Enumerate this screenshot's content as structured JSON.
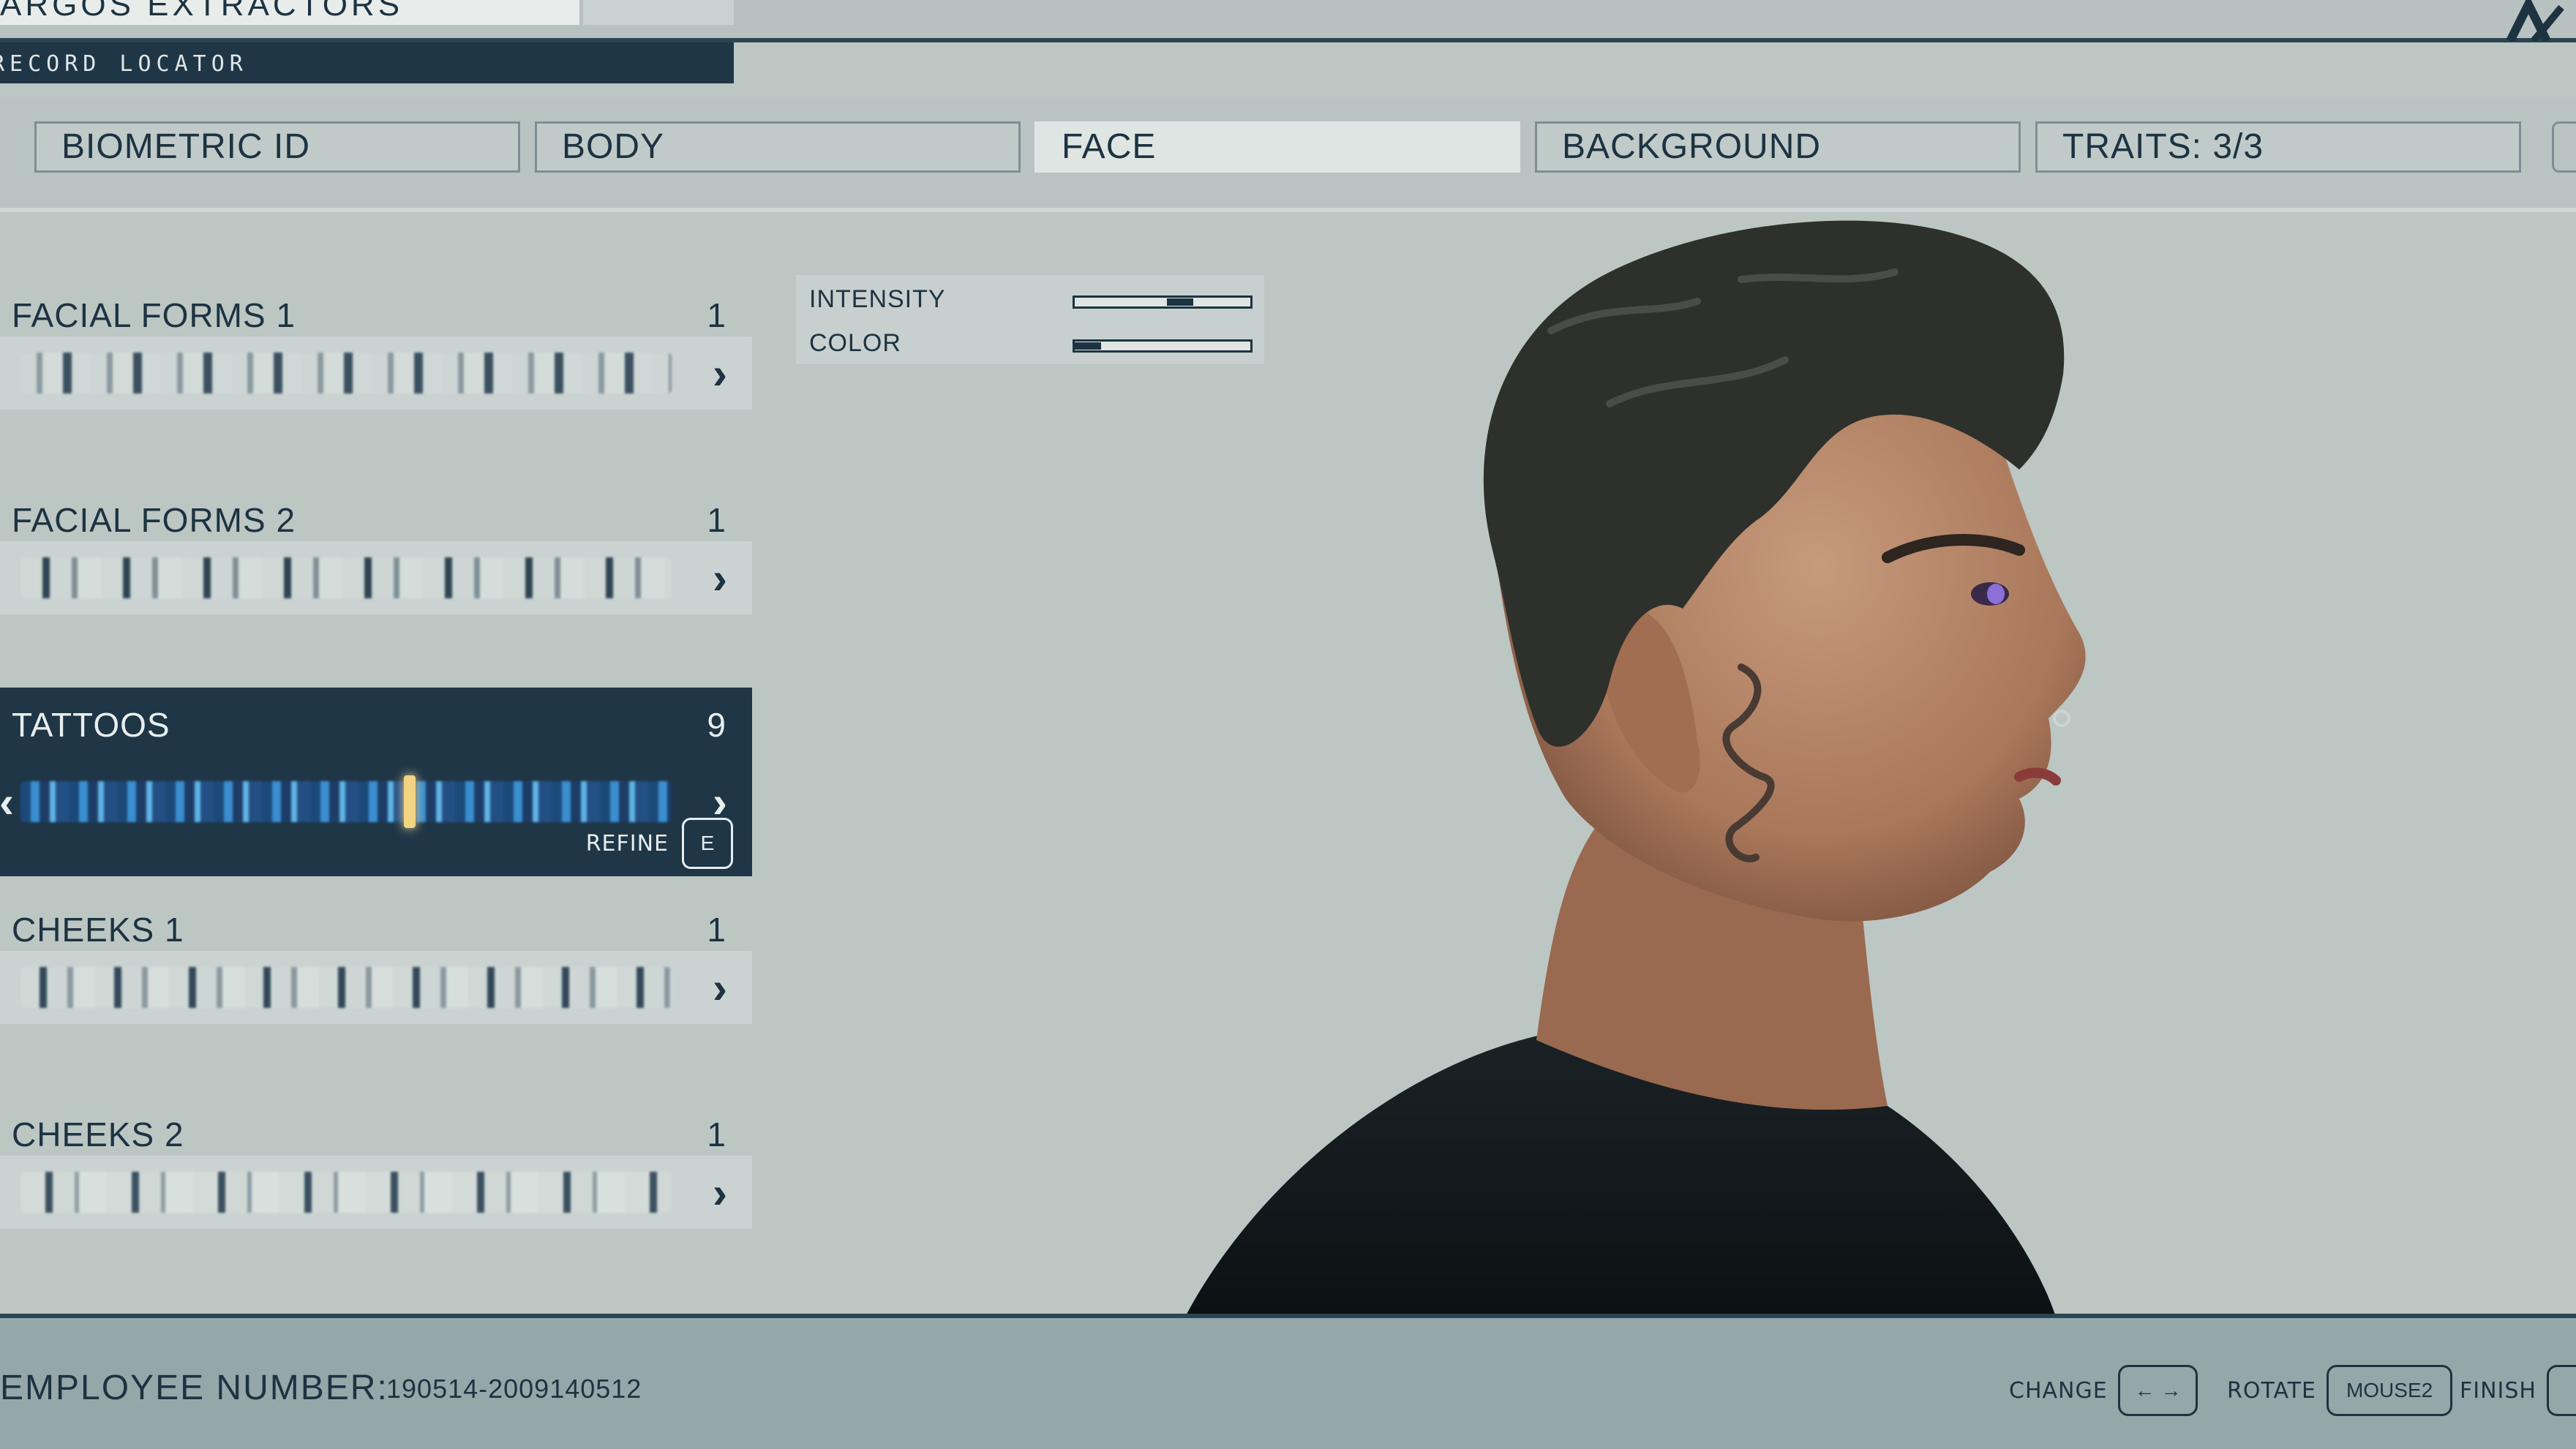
{
  "header": {
    "company": "ARGOS EXTRACTORS",
    "section": "RECORD LOCATOR"
  },
  "tabs": [
    {
      "label": "BIOMETRIC ID",
      "active": false
    },
    {
      "label": "BODY",
      "active": false
    },
    {
      "label": "FACE",
      "active": true
    },
    {
      "label": "BACKGROUND",
      "active": false
    },
    {
      "label": "TRAITS: 3/3",
      "active": false
    }
  ],
  "sliders": [
    {
      "label": "FACIAL FORMS 1",
      "value": "1",
      "selected": false
    },
    {
      "label": "FACIAL FORMS 2",
      "value": "1",
      "selected": false
    },
    {
      "label": "TATTOOS",
      "value": "9",
      "selected": true
    },
    {
      "label": "CHEEKS 1",
      "value": "1",
      "selected": false
    },
    {
      "label": "CHEEKS 2",
      "value": "1",
      "selected": false
    }
  ],
  "refine": {
    "label": "REFINE",
    "key": "E"
  },
  "adjust": {
    "intensity_label": "INTENSITY",
    "intensity_level": 0.6,
    "color_label": "COLOR",
    "color_level": 0.15
  },
  "footer": {
    "employee_label": "EMPLOYEE NUMBER:",
    "employee_number": "190514-2009140512",
    "change_label": "CHANGE",
    "change_keys": "← →",
    "rotate_label": "ROTATE",
    "rotate_key": "MOUSE2",
    "finish_label": "FINISH"
  },
  "colors": {
    "panel_dark": "#1f3647",
    "background": "#bcc7c4",
    "accent_gold": "#f4d483",
    "tattoo_blue": "#2a6fb0"
  }
}
